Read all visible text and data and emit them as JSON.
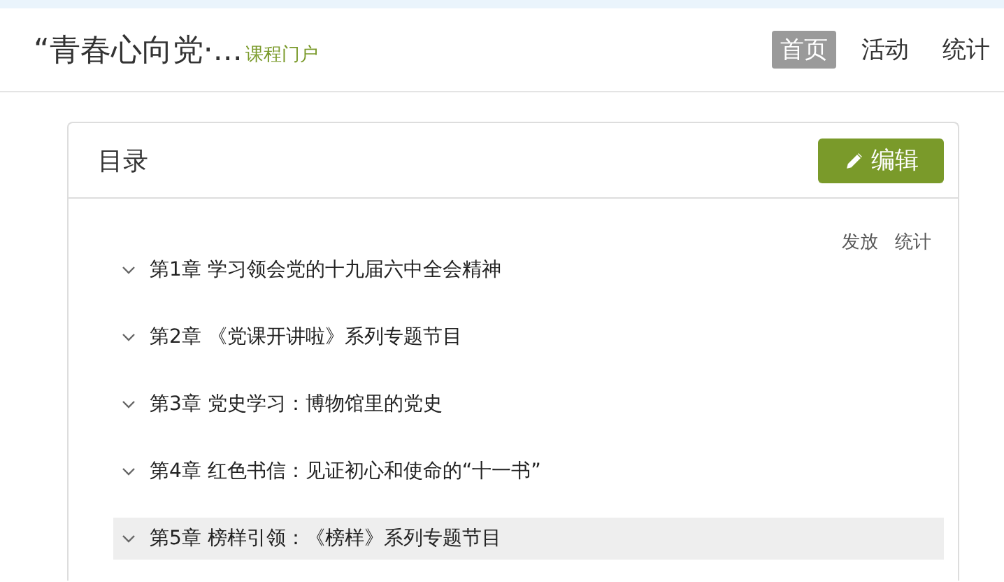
{
  "header": {
    "course_title": "“青春心向党·...",
    "portal_label": "课程门户",
    "nav": [
      {
        "label": "首页",
        "selected": true
      },
      {
        "label": "活动",
        "selected": false
      },
      {
        "label": "统计",
        "selected": false
      }
    ]
  },
  "catalog": {
    "title": "目录",
    "edit_button": "编辑",
    "actions": [
      "发放",
      "统计"
    ],
    "chapters": [
      {
        "label": "第1章 学习领会党的十九届六中全会精神",
        "expanded": true,
        "highlighted": false
      },
      {
        "label": "第2章 《党课开讲啦》系列专题节目",
        "expanded": true,
        "highlighted": false
      },
      {
        "label": "第3章 党史学习：博物馆里的党史",
        "expanded": true,
        "highlighted": false
      },
      {
        "label": "第4章 红色书信：见证初心和使命的“十一书”",
        "expanded": true,
        "highlighted": false
      },
      {
        "label": "第5章 榜样引领：《榜样》系列专题节目",
        "expanded": true,
        "highlighted": true
      }
    ]
  }
}
